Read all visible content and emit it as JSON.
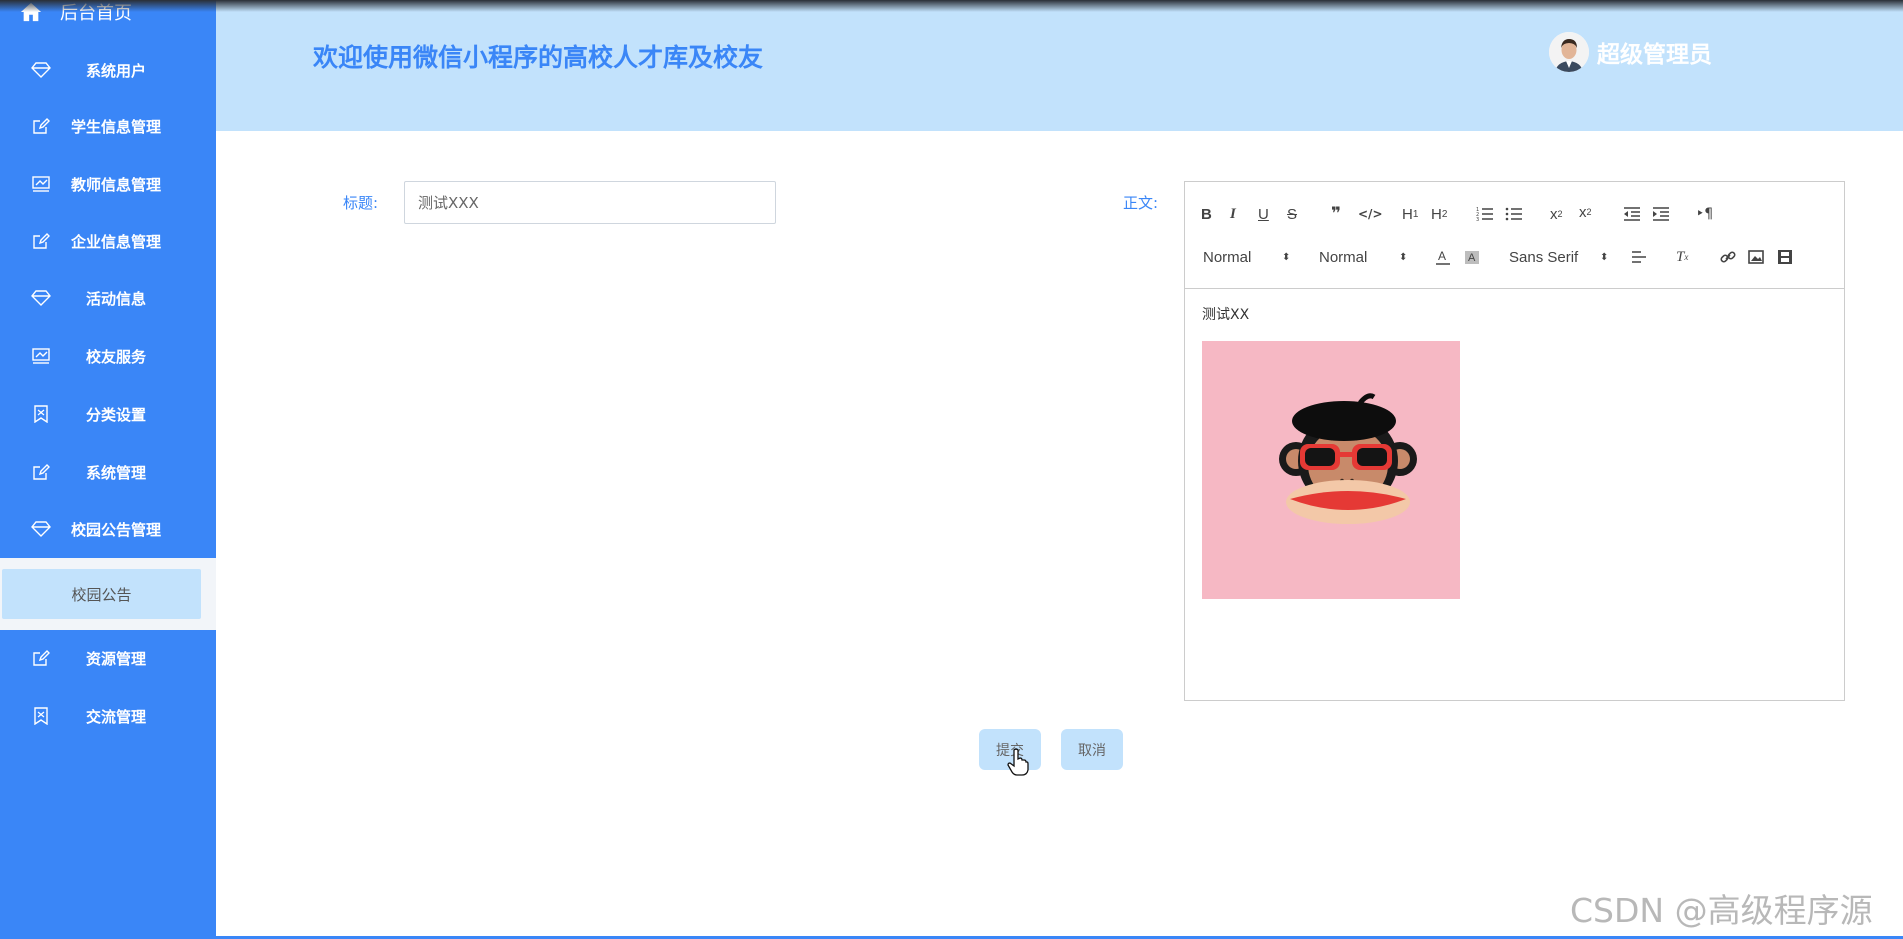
{
  "sidebar": {
    "home_label": "后台首页",
    "items": [
      {
        "label": "系统用户",
        "icon": "diamond-icon"
      },
      {
        "label": "学生信息管理",
        "icon": "edit-icon"
      },
      {
        "label": "教师信息管理",
        "icon": "chart-icon"
      },
      {
        "label": "企业信息管理",
        "icon": "edit-icon"
      },
      {
        "label": "活动信息",
        "icon": "diamond-icon"
      },
      {
        "label": "校友服务",
        "icon": "chart-icon"
      },
      {
        "label": "分类设置",
        "icon": "bookmark-icon"
      },
      {
        "label": "系统管理",
        "icon": "edit-icon"
      },
      {
        "label": "校园公告管理",
        "icon": "diamond-icon"
      },
      {
        "label": "资源管理",
        "icon": "edit-icon"
      },
      {
        "label": "交流管理",
        "icon": "bookmark-icon"
      }
    ],
    "submenu": {
      "label": "校园公告"
    }
  },
  "header": {
    "welcome": "欢迎使用微信小程序的高校人才库及校友",
    "user_name": "超级管理员"
  },
  "form": {
    "title_label": "标题:",
    "title_value": "测试XXX",
    "body_label": "正文:",
    "editor": {
      "header_select": "Normal",
      "size_select": "Normal",
      "font_select": "Sans Serif",
      "content_text": "测试XX"
    },
    "submit_label": "提交",
    "cancel_label": "取消"
  },
  "watermark": "CSDN @高级程序源",
  "colors": {
    "accent": "#3a86f7",
    "header_bg": "#c2e2fc",
    "sidebar_bg": "#3a86f7"
  }
}
